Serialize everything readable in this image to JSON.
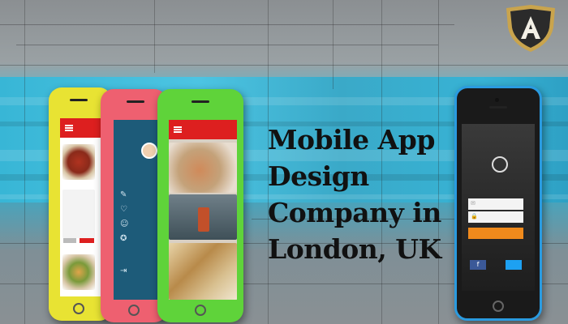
{
  "headline": {
    "line1": "Mobile App",
    "line2": "Design",
    "line3": "Company in",
    "line4": "London, UK"
  },
  "logo": {
    "letter": "A",
    "color": "#2b2b2b",
    "accent": "#c9a44d"
  },
  "login_screen": {
    "email_placeholder": "",
    "password_placeholder": "",
    "facebook_letter": "f",
    "twitter_glyph": "🐦"
  },
  "colors": {
    "app_red": "#dd1f1f",
    "phone_yellow": "#e8e333",
    "phone_pink": "#ee6070",
    "phone_green": "#5fd33a",
    "phone_blue": "#2a9be0",
    "login_orange": "#f08a1c"
  }
}
